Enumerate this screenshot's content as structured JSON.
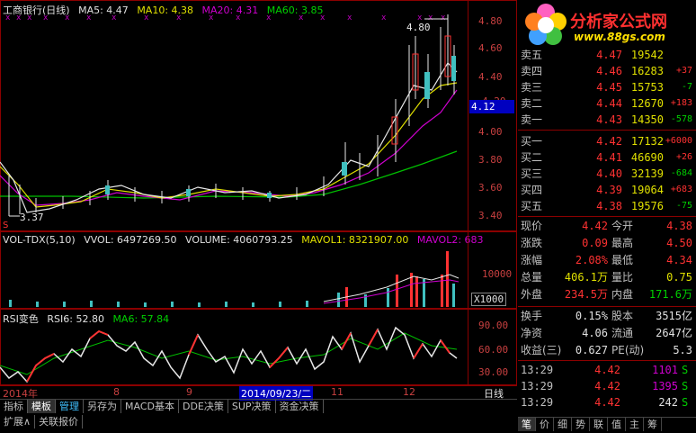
{
  "header": {
    "title": "工商银行(日线)",
    "ma5": "MA5: 4.47",
    "ma10": "MA10: 4.38",
    "ma20": "MA20: 4.31",
    "ma60": "MA60: 3.85"
  },
  "main_chart": {
    "price_axis": [
      "4.80",
      "4.60",
      "4.40",
      "4.20",
      "4.00",
      "3.80",
      "3.60",
      "3.40"
    ],
    "current_price_tag": "4.12",
    "high_mark": "4.80",
    "low_mark": "3.37",
    "s_marker": "S"
  },
  "volume_panel": {
    "header": "VOL-TDX(5,10)",
    "vvol": "VVOL: 6497269.50",
    "volume": "VOLUME: 4060793.25",
    "mavol1": "MAVOL1: 8321907.00",
    "mavol2": "MAVOL2: 683",
    "axis_top": "10000",
    "axis_unit": "X1000"
  },
  "rsi_panel": {
    "header": "RSI变色",
    "rsi6": "RSI6: 52.80",
    "ma6": "MA6: 57.84",
    "axis": [
      "90.00",
      "60.00",
      "30.00"
    ]
  },
  "date_axis": {
    "year": "2014年",
    "months": [
      "8",
      "9",
      "11",
      "12"
    ],
    "cursor_date": "2014/09/23/二",
    "period": "日线"
  },
  "bottom_tabs": [
    "指标",
    "模板",
    "管理",
    "另存为",
    "MACD基本",
    "DDE决策",
    "SUP决策",
    "资金决策"
  ],
  "bottom_tabs2": [
    "扩展∧",
    "关联报价"
  ],
  "logo": {
    "name": "分析家公式网",
    "url_text": "www.88gs.com"
  },
  "order_book": {
    "asks": [
      {
        "label": "卖五",
        "price": "4.47",
        "vol": "19542",
        "chg": ""
      },
      {
        "label": "卖四",
        "price": "4.46",
        "vol": "16283",
        "chg": "+37"
      },
      {
        "label": "卖三",
        "price": "4.45",
        "vol": "15753",
        "chg": "-7"
      },
      {
        "label": "卖二",
        "price": "4.44",
        "vol": "12670",
        "chg": "+183"
      },
      {
        "label": "卖一",
        "price": "4.43",
        "vol": "14350",
        "chg": "-578"
      }
    ],
    "bids": [
      {
        "label": "买一",
        "price": "4.42",
        "vol": "17132",
        "chg": "+6000"
      },
      {
        "label": "买二",
        "price": "4.41",
        "vol": "46690",
        "chg": "+26"
      },
      {
        "label": "买三",
        "price": "4.40",
        "vol": "32139",
        "chg": "-684"
      },
      {
        "label": "买四",
        "price": "4.39",
        "vol": "19064",
        "chg": "+683"
      },
      {
        "label": "买五",
        "price": "4.38",
        "vol": "19576",
        "chg": "-75"
      }
    ]
  },
  "stats": [
    {
      "l1": "现价",
      "v1": "4.42",
      "c1": "red",
      "l2": "今开",
      "v2": "4.38",
      "c2": "red"
    },
    {
      "l1": "涨跌",
      "v1": "0.09",
      "c1": "red",
      "l2": "最高",
      "v2": "4.50",
      "c2": "red"
    },
    {
      "l1": "涨幅",
      "v1": "2.08%",
      "c1": "red",
      "l2": "最低",
      "v2": "4.34",
      "c2": "red"
    },
    {
      "l1": "总量",
      "v1": "406.1万",
      "c1": "yellow",
      "l2": "量比",
      "v2": "0.75",
      "c2": "yellow"
    },
    {
      "l1": "外盘",
      "v1": "234.5万",
      "c1": "red",
      "l2": "内盘",
      "v2": "171.6万",
      "c2": "green"
    }
  ],
  "stats2": [
    {
      "l1": "换手",
      "v1": "0.15%",
      "c1": "white",
      "l2": "股本",
      "v2": "3515亿",
      "c2": "white"
    },
    {
      "l1": "净资",
      "v1": "4.06",
      "c1": "white",
      "l2": "流通",
      "v2": "2647亿",
      "c2": "white"
    },
    {
      "l1": "收益(三)",
      "v1": "0.627",
      "c1": "white",
      "l2": "PE(动)",
      "v2": "5.3",
      "c2": "white"
    }
  ],
  "ticks": [
    {
      "time": "13:29",
      "price": "4.42",
      "vol": "1101",
      "vcolor": "purple",
      "side": "S"
    },
    {
      "time": "13:29",
      "price": "4.42",
      "vol": "1395",
      "vcolor": "purple",
      "side": "S"
    },
    {
      "time": "13:29",
      "price": "4.42",
      "vol": "242",
      "vcolor": "white",
      "side": "S"
    }
  ],
  "right_tabs": [
    "笔",
    "价",
    "细",
    "势",
    "联",
    "值",
    "主",
    "筹"
  ]
}
